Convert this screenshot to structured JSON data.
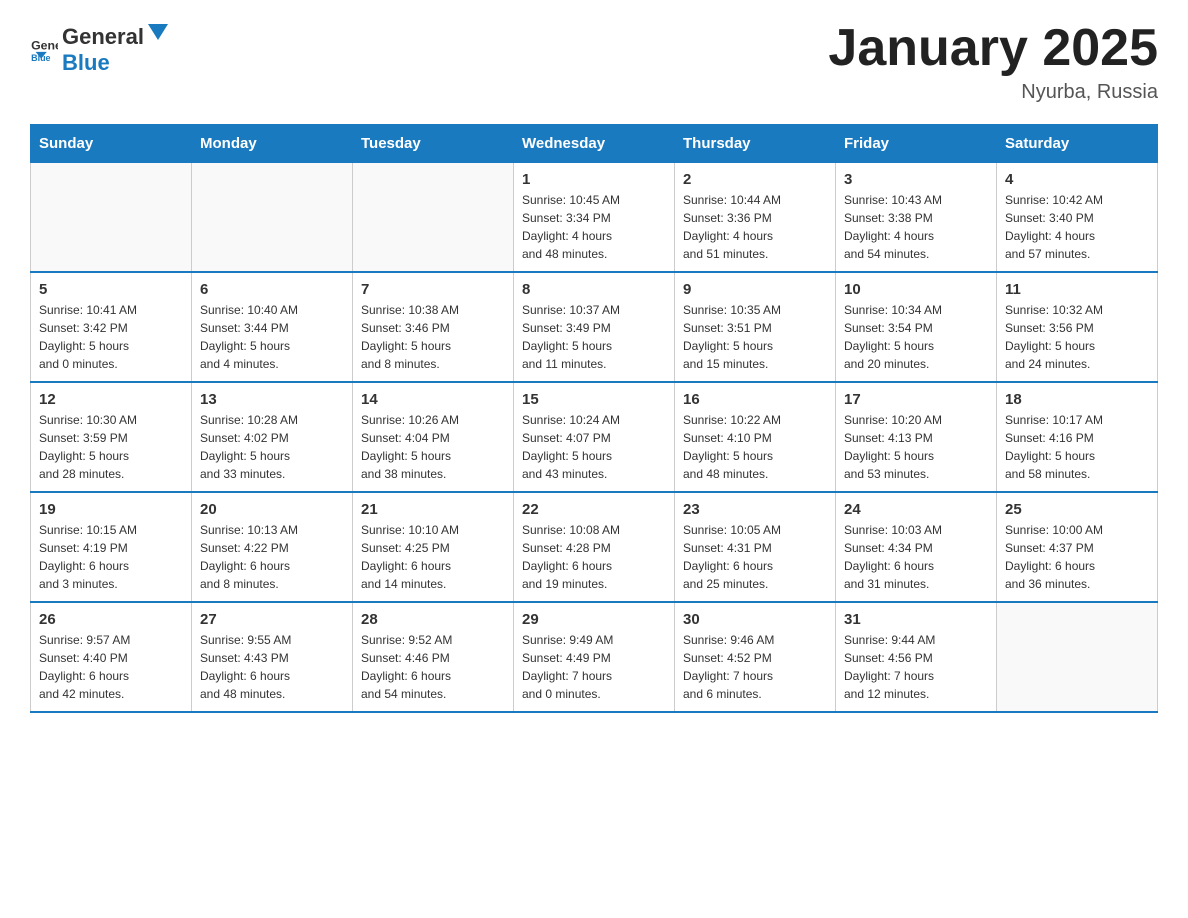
{
  "logo": {
    "general": "General",
    "blue": "Blue"
  },
  "title": "January 2025",
  "subtitle": "Nyurba, Russia",
  "days_of_week": [
    "Sunday",
    "Monday",
    "Tuesday",
    "Wednesday",
    "Thursday",
    "Friday",
    "Saturday"
  ],
  "weeks": [
    [
      {
        "num": "",
        "info": ""
      },
      {
        "num": "",
        "info": ""
      },
      {
        "num": "",
        "info": ""
      },
      {
        "num": "1",
        "info": "Sunrise: 10:45 AM\nSunset: 3:34 PM\nDaylight: 4 hours\nand 48 minutes."
      },
      {
        "num": "2",
        "info": "Sunrise: 10:44 AM\nSunset: 3:36 PM\nDaylight: 4 hours\nand 51 minutes."
      },
      {
        "num": "3",
        "info": "Sunrise: 10:43 AM\nSunset: 3:38 PM\nDaylight: 4 hours\nand 54 minutes."
      },
      {
        "num": "4",
        "info": "Sunrise: 10:42 AM\nSunset: 3:40 PM\nDaylight: 4 hours\nand 57 minutes."
      }
    ],
    [
      {
        "num": "5",
        "info": "Sunrise: 10:41 AM\nSunset: 3:42 PM\nDaylight: 5 hours\nand 0 minutes."
      },
      {
        "num": "6",
        "info": "Sunrise: 10:40 AM\nSunset: 3:44 PM\nDaylight: 5 hours\nand 4 minutes."
      },
      {
        "num": "7",
        "info": "Sunrise: 10:38 AM\nSunset: 3:46 PM\nDaylight: 5 hours\nand 8 minutes."
      },
      {
        "num": "8",
        "info": "Sunrise: 10:37 AM\nSunset: 3:49 PM\nDaylight: 5 hours\nand 11 minutes."
      },
      {
        "num": "9",
        "info": "Sunrise: 10:35 AM\nSunset: 3:51 PM\nDaylight: 5 hours\nand 15 minutes."
      },
      {
        "num": "10",
        "info": "Sunrise: 10:34 AM\nSunset: 3:54 PM\nDaylight: 5 hours\nand 20 minutes."
      },
      {
        "num": "11",
        "info": "Sunrise: 10:32 AM\nSunset: 3:56 PM\nDaylight: 5 hours\nand 24 minutes."
      }
    ],
    [
      {
        "num": "12",
        "info": "Sunrise: 10:30 AM\nSunset: 3:59 PM\nDaylight: 5 hours\nand 28 minutes."
      },
      {
        "num": "13",
        "info": "Sunrise: 10:28 AM\nSunset: 4:02 PM\nDaylight: 5 hours\nand 33 minutes."
      },
      {
        "num": "14",
        "info": "Sunrise: 10:26 AM\nSunset: 4:04 PM\nDaylight: 5 hours\nand 38 minutes."
      },
      {
        "num": "15",
        "info": "Sunrise: 10:24 AM\nSunset: 4:07 PM\nDaylight: 5 hours\nand 43 minutes."
      },
      {
        "num": "16",
        "info": "Sunrise: 10:22 AM\nSunset: 4:10 PM\nDaylight: 5 hours\nand 48 minutes."
      },
      {
        "num": "17",
        "info": "Sunrise: 10:20 AM\nSunset: 4:13 PM\nDaylight: 5 hours\nand 53 minutes."
      },
      {
        "num": "18",
        "info": "Sunrise: 10:17 AM\nSunset: 4:16 PM\nDaylight: 5 hours\nand 58 minutes."
      }
    ],
    [
      {
        "num": "19",
        "info": "Sunrise: 10:15 AM\nSunset: 4:19 PM\nDaylight: 6 hours\nand 3 minutes."
      },
      {
        "num": "20",
        "info": "Sunrise: 10:13 AM\nSunset: 4:22 PM\nDaylight: 6 hours\nand 8 minutes."
      },
      {
        "num": "21",
        "info": "Sunrise: 10:10 AM\nSunset: 4:25 PM\nDaylight: 6 hours\nand 14 minutes."
      },
      {
        "num": "22",
        "info": "Sunrise: 10:08 AM\nSunset: 4:28 PM\nDaylight: 6 hours\nand 19 minutes."
      },
      {
        "num": "23",
        "info": "Sunrise: 10:05 AM\nSunset: 4:31 PM\nDaylight: 6 hours\nand 25 minutes."
      },
      {
        "num": "24",
        "info": "Sunrise: 10:03 AM\nSunset: 4:34 PM\nDaylight: 6 hours\nand 31 minutes."
      },
      {
        "num": "25",
        "info": "Sunrise: 10:00 AM\nSunset: 4:37 PM\nDaylight: 6 hours\nand 36 minutes."
      }
    ],
    [
      {
        "num": "26",
        "info": "Sunrise: 9:57 AM\nSunset: 4:40 PM\nDaylight: 6 hours\nand 42 minutes."
      },
      {
        "num": "27",
        "info": "Sunrise: 9:55 AM\nSunset: 4:43 PM\nDaylight: 6 hours\nand 48 minutes."
      },
      {
        "num": "28",
        "info": "Sunrise: 9:52 AM\nSunset: 4:46 PM\nDaylight: 6 hours\nand 54 minutes."
      },
      {
        "num": "29",
        "info": "Sunrise: 9:49 AM\nSunset: 4:49 PM\nDaylight: 7 hours\nand 0 minutes."
      },
      {
        "num": "30",
        "info": "Sunrise: 9:46 AM\nSunset: 4:52 PM\nDaylight: 7 hours\nand 6 minutes."
      },
      {
        "num": "31",
        "info": "Sunrise: 9:44 AM\nSunset: 4:56 PM\nDaylight: 7 hours\nand 12 minutes."
      },
      {
        "num": "",
        "info": ""
      }
    ]
  ]
}
